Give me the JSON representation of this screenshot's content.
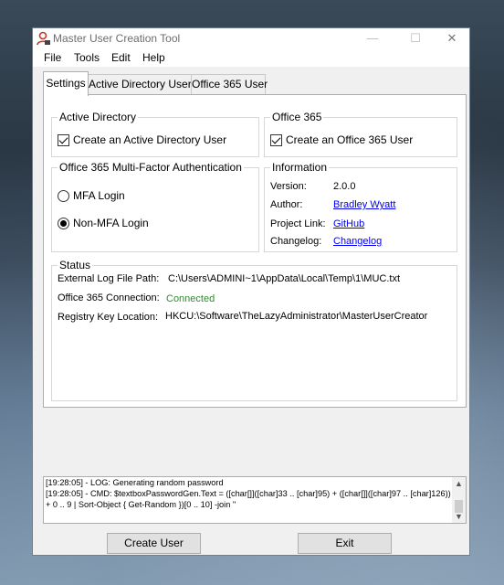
{
  "window": {
    "title": "Master User Creation Tool"
  },
  "menu": {
    "file": "File",
    "tools": "Tools",
    "edit": "Edit",
    "help": "Help"
  },
  "tabs": {
    "settings": "Settings",
    "active_directory_user": "Active Directory User",
    "office365_user": "Office 365 User",
    "active": "Settings"
  },
  "active_directory": {
    "title": "Active Directory",
    "checkbox_label": "Create an Active Directory User",
    "checked": true
  },
  "office365": {
    "title": "Office 365",
    "checkbox_label": "Create an Office 365 User",
    "checked": true
  },
  "mfa": {
    "title": "Office 365 Multi-Factor Authentication",
    "mfa_login": "MFA Login",
    "non_mfa_login": "Non-MFA Login",
    "selected": "Non-MFA Login"
  },
  "information": {
    "title": "Information",
    "version_label": "Version:",
    "version_value": "2.0.0",
    "author_label": "Author:",
    "author_value": "Bradley Wyatt",
    "project_link_label": "Project Link:",
    "project_link_value": "GitHub",
    "changelog_label": "Changelog:",
    "changelog_value": "Changelog"
  },
  "status": {
    "title": "Status",
    "log_path_label": "External Log File Path:",
    "log_path_value": "C:\\Users\\ADMINI~1\\AppData\\Local\\Temp\\1\\MUC.txt",
    "connection_label": "Office 365 Connection:",
    "connection_value": "Connected",
    "registry_label": "Registry Key Location:",
    "registry_value": "HKCU:\\Software\\TheLazyAdministrator\\MasterUserCreator"
  },
  "log": {
    "lines": [
      "[19:28:05] - LOG: Generating random password",
      "[19:28:05] - CMD: $textboxPasswordGen.Text = ([char[]]([char]33 .. [char]95) + ([char[]]([char]97 .. [char]126))",
      "+ 0 .. 9 | Sort-Object { Get-Random })[0 .. 10] -join ''"
    ]
  },
  "buttons": {
    "create_user": "Create User",
    "exit": "Exit"
  },
  "colors": {
    "link": "#0000ee",
    "connected": "#2e8b2e",
    "window_bg": "#f0f0f0"
  }
}
